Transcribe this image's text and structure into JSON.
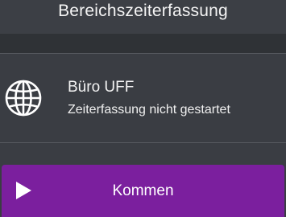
{
  "header": {
    "title": "Bereichszeiterfassung"
  },
  "location": {
    "icon": "globe-icon",
    "name": "Büro UFF",
    "status": "Zeiterfassung nicht gestartet"
  },
  "action": {
    "icon": "play-icon",
    "label": "Kommen",
    "color": "#7b1f9e"
  },
  "colors": {
    "background": "#3a3d43",
    "sub_bar": "#2f3236",
    "text": "#f4f4f4"
  }
}
